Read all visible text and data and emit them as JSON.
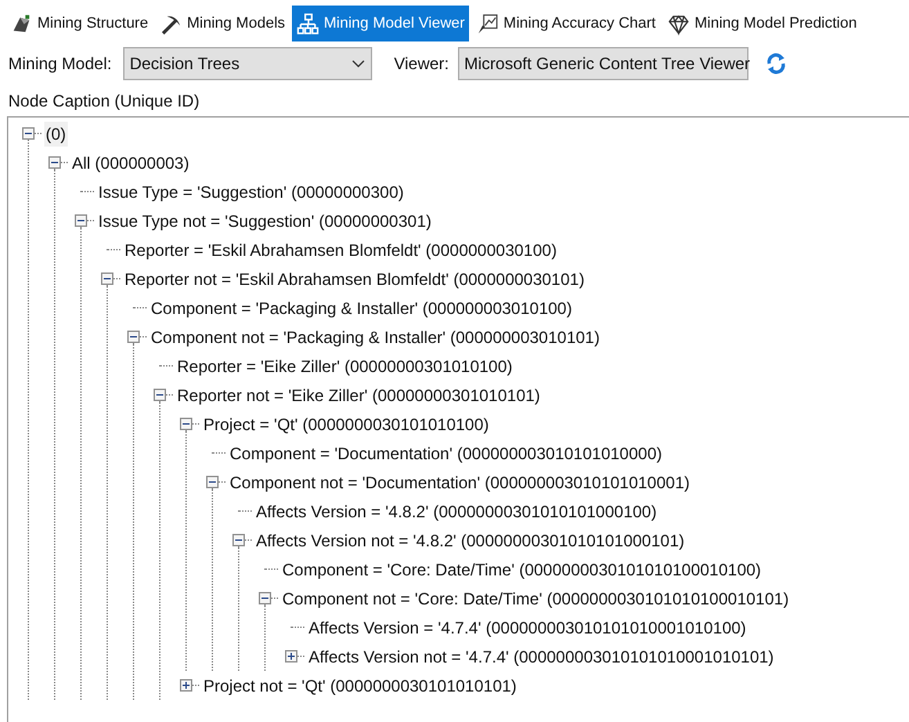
{
  "tabs": [
    {
      "label": "Mining Structure",
      "selected": false
    },
    {
      "label": "Mining Models",
      "selected": false
    },
    {
      "label": "Mining Model Viewer",
      "selected": true
    },
    {
      "label": "Mining Accuracy Chart",
      "selected": false
    },
    {
      "label": "Mining Model Prediction",
      "selected": false
    }
  ],
  "toolbar": {
    "model_label": "Mining Model:",
    "model_value": "Decision Trees",
    "viewer_label": "Viewer:",
    "viewer_value": "Microsoft Generic Content Tree Viewer"
  },
  "tree": {
    "column": "Node Caption (Unique ID)",
    "nodes": [
      {
        "label": "(0)",
        "expanded": true,
        "children": [
          {
            "label": "All (000000003)",
            "expanded": true,
            "children": [
              {
                "label": "Issue Type = 'Suggestion' (00000000300)"
              },
              {
                "label": "Issue Type not = 'Suggestion' (00000000301)",
                "expanded": true,
                "children": [
                  {
                    "label": "Reporter = 'Eskil Abrahamsen Blomfeldt' (0000000030100)"
                  },
                  {
                    "label": "Reporter not = 'Eskil Abrahamsen Blomfeldt' (0000000030101)",
                    "expanded": true,
                    "children": [
                      {
                        "label": "Component = 'Packaging & Installer' (000000003010100)"
                      },
                      {
                        "label": "Component not = 'Packaging & Installer' (000000003010101)",
                        "expanded": true,
                        "children": [
                          {
                            "label": "Reporter = 'Eike Ziller' (00000000301010100)"
                          },
                          {
                            "label": "Reporter not = 'Eike Ziller' (00000000301010101)",
                            "expanded": true,
                            "children": [
                              {
                                "label": "Project = 'Qt' (0000000030101010100)",
                                "expanded": true,
                                "children": [
                                  {
                                    "label": "Component = 'Documentation' (000000003010101010000)"
                                  },
                                  {
                                    "label": "Component not = 'Documentation' (000000003010101010001)",
                                    "expanded": true,
                                    "children": [
                                      {
                                        "label": "Affects Version = '4.8.2' (00000000301010101000100)"
                                      },
                                      {
                                        "label": "Affects Version not = '4.8.2' (00000000301010101000101)",
                                        "expanded": true,
                                        "children": [
                                          {
                                            "label": "Component = 'Core: Date/Time' (0000000030101010100010100)"
                                          },
                                          {
                                            "label": "Component not = 'Core: Date/Time' (0000000030101010100010101)",
                                            "expanded": true,
                                            "children": [
                                              {
                                                "label": "Affects Version = '4.7.4' (000000003010101010001010100)"
                                              },
                                              {
                                                "label": "Affects Version not = '4.7.4' (000000003010101010001010101)",
                                                "expanded": false
                                              }
                                            ]
                                          }
                                        ]
                                      }
                                    ]
                                  }
                                ]
                              },
                              {
                                "label": "Project not = 'Qt' (0000000030101010101)",
                                "expanded": false
                              }
                            ]
                          }
                        ]
                      }
                    ]
                  }
                ]
              }
            ]
          }
        ]
      }
    ]
  }
}
